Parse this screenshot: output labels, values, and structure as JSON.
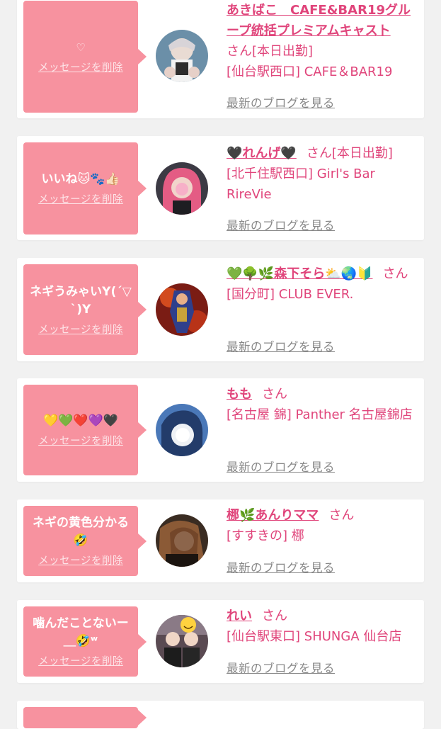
{
  "delete_label": "メッセージを削除",
  "blog_label": "最新のブログを見る",
  "san_label": "さん",
  "colors": {
    "pink_bubble": "#f7929f",
    "accent": "#e0457b",
    "muted": "#888888",
    "background": "#f1f1f1"
  },
  "entries": [
    {
      "message": "♡",
      "name": "あきばこ　CAFE&BAR19グループ統括プレミアムキャスト",
      "status": "[本日出勤]",
      "shop": "[仙台駅西口] CAFE＆BAR19"
    },
    {
      "message": "いいね🐱🐾👍🏻",
      "name": "🖤れんげ🖤",
      "status": "[本日出勤]",
      "shop": "[北千住駅西口] Girl's Bar RireVie"
    },
    {
      "message": "ネギうみゃいY(´▽`)Y",
      "name": "💚🌳🌿森下そら⛅🌏🔰",
      "status": "",
      "shop": "[国分町] CLUB EVER."
    },
    {
      "message": "💛💚❤️💜🖤",
      "name": "もも",
      "status": "",
      "shop": "[名古屋 錦] Panther 名古屋錦店"
    },
    {
      "message": "ネギの黄色分かる🤣",
      "name": "梛🌿あんりママ",
      "status": "",
      "shop": "[すすきの] 梛"
    },
    {
      "message": "噛んだことないー＿🤣ʷ",
      "name": "れい",
      "status": "",
      "shop": "[仙台駅東口] SHUNGA 仙台店"
    }
  ]
}
